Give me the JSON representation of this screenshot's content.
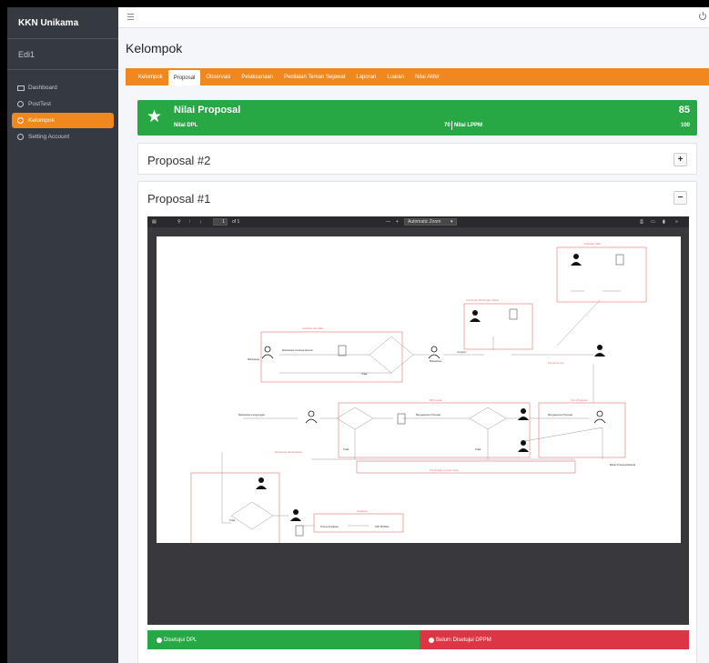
{
  "app": {
    "brand": "KKN Unikama",
    "user": "Edi1"
  },
  "sidebar": {
    "items": [
      {
        "label": "Dashboard",
        "icon": "dashboard-icon"
      },
      {
        "label": "PostTest",
        "icon": "circle-icon"
      },
      {
        "label": "Kelompok",
        "icon": "circle-icon",
        "active": true
      },
      {
        "label": "Setting Account",
        "icon": "circle-icon"
      }
    ]
  },
  "page": {
    "title": "Kelompok"
  },
  "tabs": [
    "Kelompok",
    "Proposal",
    "Observasi",
    "Pelaksanaan",
    "Penilaian Teman Sejawat",
    "Laporan",
    "Luaran",
    "Nilai Akhir"
  ],
  "active_tab": "Proposal",
  "score": {
    "title": "Nilai Proposal",
    "dpl_label": "Nilai DPL",
    "dpl_value": "70",
    "lppm_label": "Nilai LPPM",
    "total": "85",
    "lppm_value": "100"
  },
  "cards": [
    {
      "title": "Proposal #2",
      "toggle": "+"
    },
    {
      "title": "Proposal #1",
      "toggle": "−"
    }
  ],
  "viewer": {
    "page_number": "1",
    "page_of": "of 1",
    "zoom": "Automatic Zoom"
  },
  "actions": {
    "approve": "Disetujui DPL",
    "reject": "Belum Disetujui DPPM"
  },
  "colors": {
    "accent": "#f0871f",
    "success": "#28a745",
    "danger": "#dc3545",
    "sidebar": "#343a40"
  }
}
